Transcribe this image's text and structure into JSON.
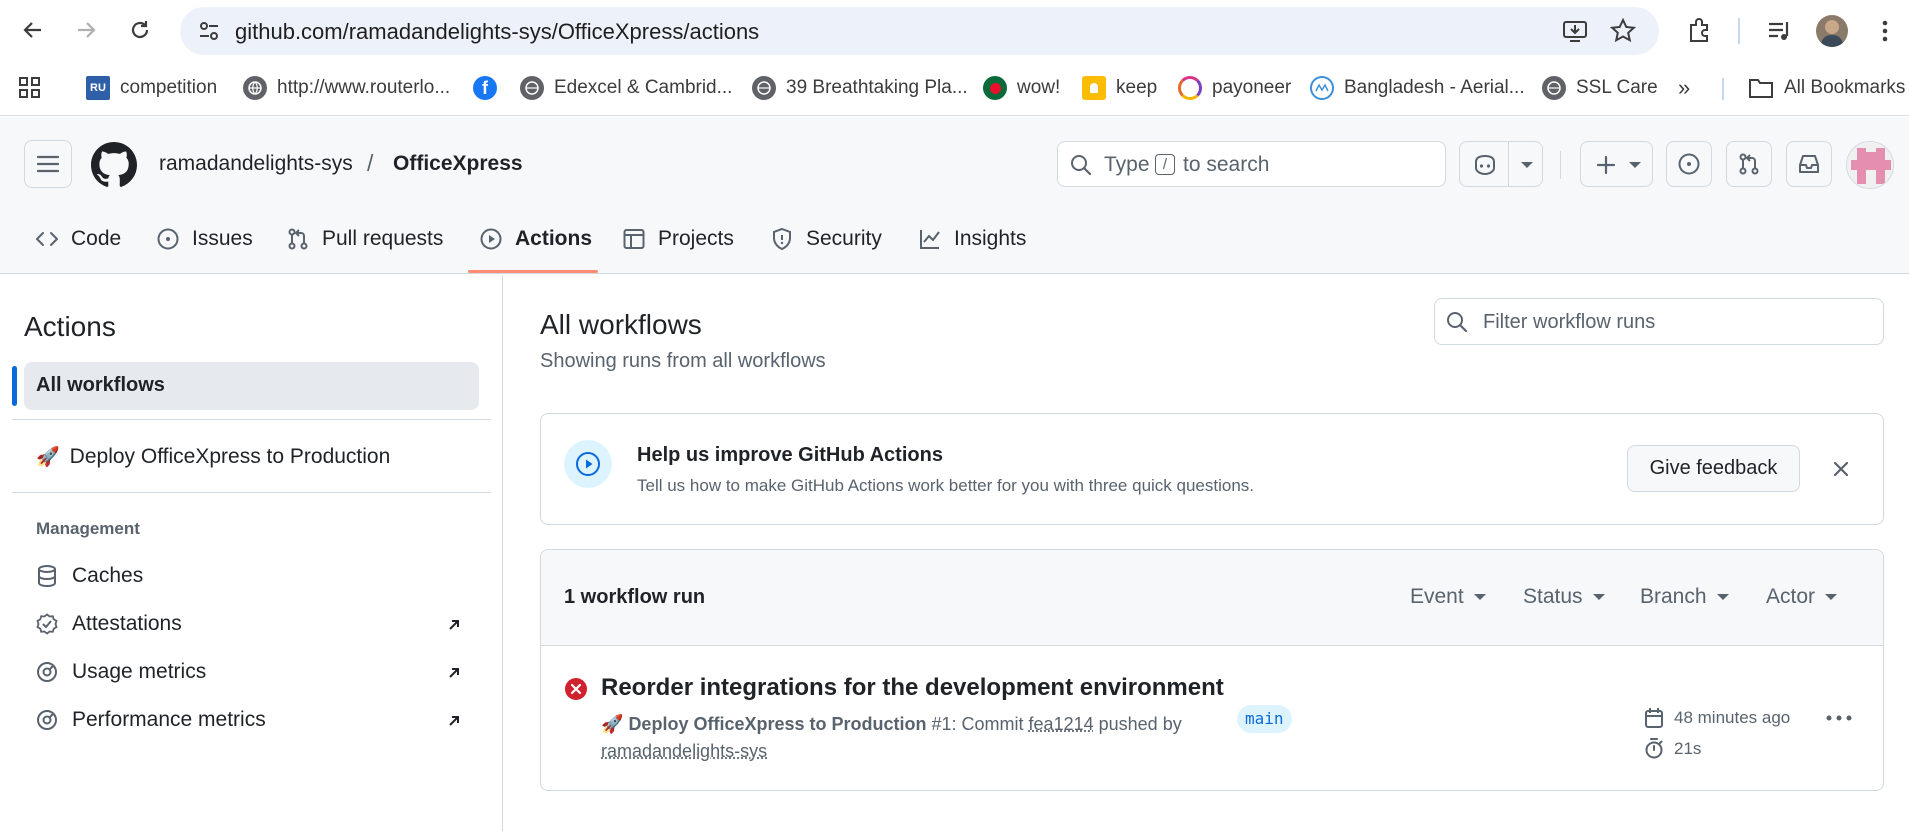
{
  "browser": {
    "url": "github.com/ramadandelights-sys/OfficeXpress/actions",
    "bookmarks": [
      {
        "label": "competition",
        "icon": "rr-icon"
      },
      {
        "label": "http://www.routerlo...",
        "icon": "globe-icon"
      },
      {
        "label": "",
        "icon": "facebook-icon"
      },
      {
        "label": "Edexcel & Cambrid...",
        "icon": "globe-icon"
      },
      {
        "label": "39 Breathtaking Pla...",
        "icon": "globe-icon"
      },
      {
        "label": "wow!",
        "icon": "flag-bd-icon"
      },
      {
        "label": "keep",
        "icon": "keep-icon"
      },
      {
        "label": "payoneer",
        "icon": "payoneer-icon"
      },
      {
        "label": "Bangladesh - Aerial...",
        "icon": "aerial-icon"
      },
      {
        "label": "SSL Care",
        "icon": "globe-icon"
      }
    ],
    "all_bookmarks": "All Bookmarks"
  },
  "repo": {
    "owner": "ramadandelights-sys",
    "separator": "/",
    "name": "OfficeXpress",
    "search_prefix": "Type",
    "search_key": "/",
    "search_suffix": "to search"
  },
  "tabs": [
    {
      "label": "Code",
      "icon": "code-icon"
    },
    {
      "label": "Issues",
      "icon": "issue-icon"
    },
    {
      "label": "Pull requests",
      "icon": "pull-request-icon"
    },
    {
      "label": "Actions",
      "icon": "play-icon",
      "active": true
    },
    {
      "label": "Projects",
      "icon": "table-icon"
    },
    {
      "label": "Security",
      "icon": "shield-icon"
    },
    {
      "label": "Insights",
      "icon": "graph-icon"
    }
  ],
  "sidebar": {
    "title": "Actions",
    "all_workflows": "All workflows",
    "workflow": "Deploy OfficeXpress to Production",
    "management_heading": "Management",
    "management": [
      {
        "label": "Caches",
        "icon": "database-icon"
      },
      {
        "label": "Attestations",
        "icon": "verified-icon"
      },
      {
        "label": "Usage metrics",
        "icon": "meter-icon"
      },
      {
        "label": "Performance metrics",
        "icon": "meter-icon"
      }
    ]
  },
  "main": {
    "title": "All workflows",
    "subtitle": "Showing runs from all workflows",
    "filter_placeholder": "Filter workflow runs",
    "banner": {
      "title": "Help us improve GitHub Actions",
      "text": "Tell us how to make GitHub Actions work better for you with three quick questions.",
      "button": "Give feedback"
    },
    "runs_count": "1 workflow run",
    "filters": [
      "Event",
      "Status",
      "Branch",
      "Actor"
    ],
    "run": {
      "title": "Reorder integrations for the development environment",
      "workflow": "Deploy OfficeXpress to Production",
      "run_number": "#1: Commit",
      "commit": "fea1214",
      "pushed_by": "pushed by",
      "actor": "ramadandelights-sys",
      "branch": "main",
      "time": "48 minutes ago",
      "duration": "21s",
      "status": "failure"
    }
  },
  "colors": {
    "accent": "#fd8c73",
    "failure": "#cf222e",
    "link": "#0969da",
    "muted": "#59636e"
  }
}
